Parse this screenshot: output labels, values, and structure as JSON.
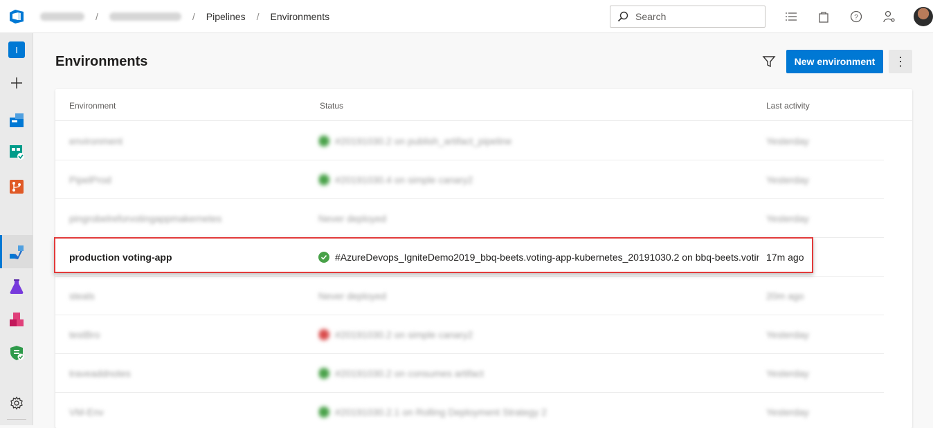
{
  "topbar": {
    "breadcrumb": {
      "org_blurred": "ifapb-mgtl",
      "project_blurred": "IgniteDemo2019",
      "pipelines": "Pipelines",
      "environments": "Environments"
    },
    "search_placeholder": "Search"
  },
  "rail": {
    "org_initial": "I",
    "items": [
      "overview",
      "boards",
      "test-plans-boards",
      "repos",
      "pipelines",
      "test-plans",
      "artifacts",
      "security"
    ],
    "active": "pipelines"
  },
  "page": {
    "title": "Environments",
    "new_button": "New environment",
    "more_button": "⋮"
  },
  "table": {
    "headers": {
      "environment": "Environment",
      "status": "Status",
      "activity": "Last activity"
    },
    "rows": [
      {
        "name": "environment",
        "status": "#20191030.2 on publish_artifact_pipeline",
        "state": "ok",
        "activity": "Yesterday",
        "blurred": true
      },
      {
        "name": "PipelProd",
        "status": "#20191030.4 on simple canary2",
        "state": "ok",
        "activity": "Yesterday",
        "blurred": true
      },
      {
        "name": "pingrobelreforvotingappmakernetes",
        "status": "Never deployed",
        "state": "none",
        "activity": "Yesterday",
        "blurred": true
      },
      {
        "name": "production voting-app",
        "status": "#AzureDevops_IgniteDemo2019_bbq-beets.voting-app-kubernetes_20191030.2 on bbq-beets.votin",
        "state": "ok",
        "activity": "17m ago",
        "blurred": false
      },
      {
        "name": "steals",
        "status": "Never deployed",
        "state": "none",
        "activity": "20m ago",
        "blurred": true
      },
      {
        "name": "testBro",
        "status": "#20191030.2 on simple canary2",
        "state": "fail",
        "activity": "Yesterday",
        "blurred": true
      },
      {
        "name": "traveaddnotes",
        "status": "#20191030.2 on consumes artifact",
        "state": "ok",
        "activity": "Yesterday",
        "blurred": true
      },
      {
        "name": "VM-Env",
        "status": "#20191030.2.1 on Rolling Deployment Strategy 2",
        "state": "ok",
        "activity": "Yesterday",
        "blurred": true
      }
    ]
  },
  "colors": {
    "accent": "#0078d4",
    "success": "#48a148",
    "failure": "#d94b4b",
    "highlight_border": "#e23a3a"
  }
}
